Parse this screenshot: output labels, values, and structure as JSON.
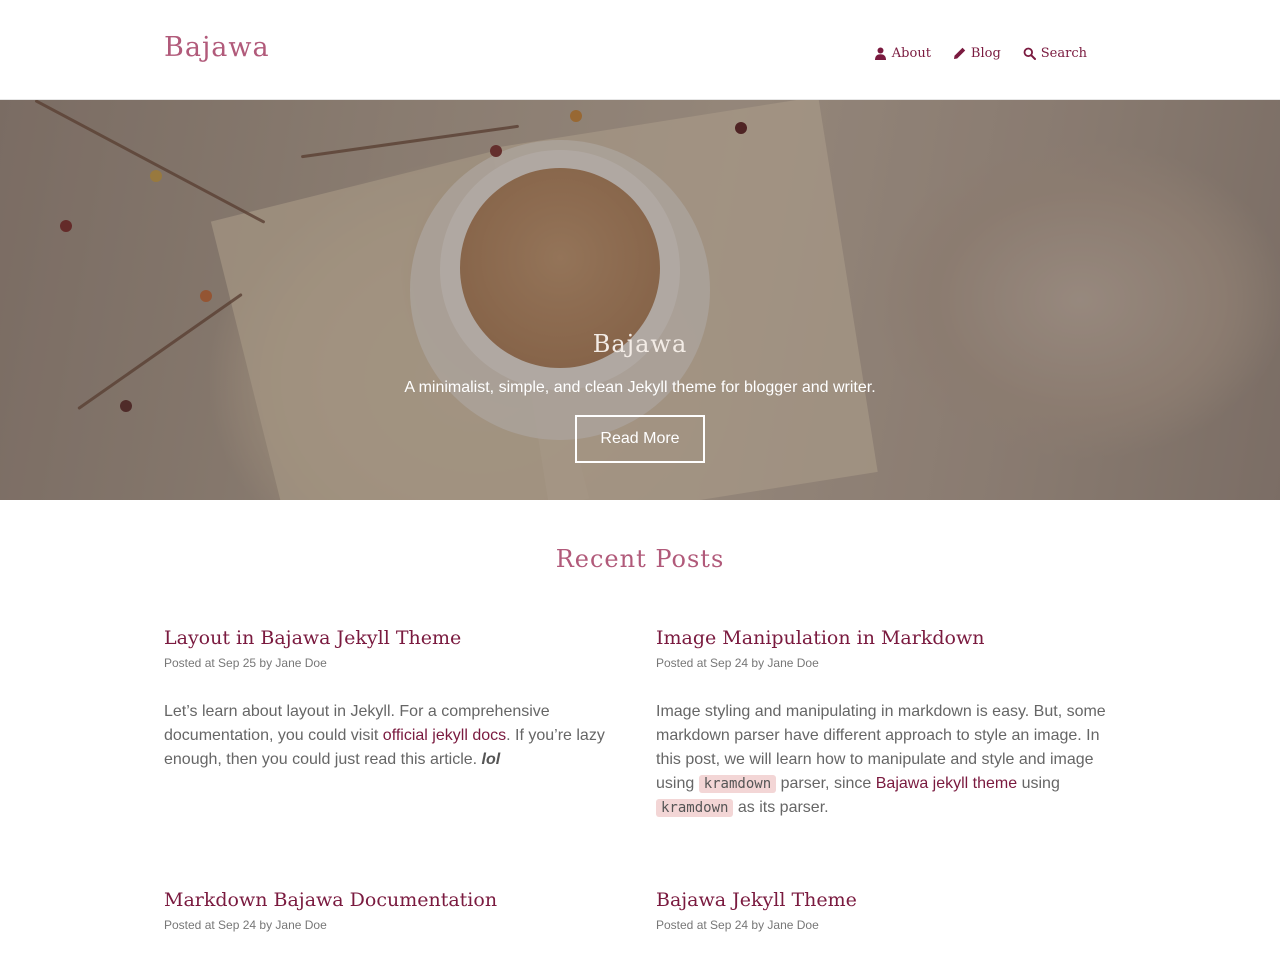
{
  "header": {
    "site_title": "Bajawa",
    "nav": [
      {
        "label": "About",
        "icon": "user-icon"
      },
      {
        "label": "Blog",
        "icon": "pencil-icon"
      },
      {
        "label": "Search",
        "icon": "search-icon"
      }
    ]
  },
  "hero": {
    "title": "Bajawa",
    "subtitle": "A minimalist, simple, and clean Jekyll theme for blogger and writer.",
    "button_label": "Read More"
  },
  "recent_posts": {
    "heading": "Recent Posts",
    "posts": [
      {
        "title": "Layout in Bajawa Jekyll Theme",
        "meta": "Posted at Sep 25 by Jane Doe",
        "excerpt": {
          "text_1": "Let’s learn about layout in Jekyll. For a comprehensive documentation, you could visit ",
          "link_1": "official jekyll docs",
          "text_2": ". If you’re lazy enough, then you could just read this article. ",
          "emphasis": "lol"
        }
      },
      {
        "title": "Image Manipulation in Markdown",
        "meta": "Posted at Sep 24 by Jane Doe",
        "excerpt": {
          "text_1": "Image styling and manipulating in markdown is easy. But, some markdown parser have different approach to style an image. In this post, we will learn how to manipulate and style and image using ",
          "code_1": "kramdown",
          "text_2": " parser, since ",
          "link_1": "Bajawa jekyll theme",
          "text_3": " using ",
          "code_2": "kramdown",
          "text_4": " as its parser."
        }
      },
      {
        "title": "Markdown Bajawa Documentation",
        "meta": "Posted at Sep 24 by Jane Doe"
      },
      {
        "title": "Bajawa Jekyll Theme",
        "meta": "Posted at Sep 24 by Jane Doe"
      }
    ]
  },
  "colors": {
    "accent": "#7a1a3f",
    "brand_title": "#b15a7a",
    "code_background": "#f3d6d6"
  }
}
